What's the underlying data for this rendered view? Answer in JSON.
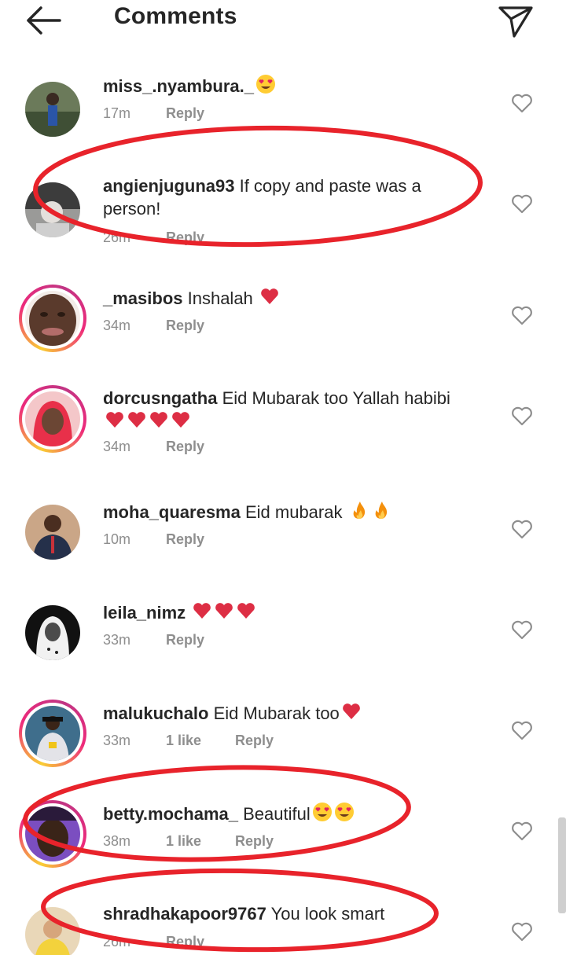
{
  "header": {
    "title": "Comments",
    "back_icon": "arrow-left-icon",
    "send_icon": "paper-plane-icon"
  },
  "comments": [
    {
      "username": "miss_.nyambura._",
      "text": "",
      "emojis": [
        "heart-eyes"
      ],
      "time": "17m",
      "likes": "",
      "reply": "Reply",
      "ring": false
    },
    {
      "username": "angienjuguna93",
      "text": " If copy and paste was a person!",
      "emojis": [],
      "time": "26m",
      "likes": "",
      "reply": "Reply",
      "ring": false
    },
    {
      "username": "_masibos",
      "text": " Inshalah ",
      "emojis": [
        "red-heart"
      ],
      "time": "34m",
      "likes": "",
      "reply": "Reply",
      "ring": true
    },
    {
      "username": "dorcusngatha",
      "text": " Eid Mubarak too Yallah habibi ",
      "emojis": [
        "red-heart",
        "red-heart",
        "red-heart",
        "red-heart"
      ],
      "time": "34m",
      "likes": "",
      "reply": "Reply",
      "ring": true
    },
    {
      "username": "moha_quaresma",
      "text": " Eid mubarak ",
      "emojis": [
        "fire",
        "fire"
      ],
      "time": "10m",
      "likes": "",
      "reply": "Reply",
      "ring": false
    },
    {
      "username": "leila_nimz",
      "text": " ",
      "emojis": [
        "red-heart",
        "red-heart",
        "red-heart"
      ],
      "time": "33m",
      "likes": "",
      "reply": "Reply",
      "ring": false
    },
    {
      "username": "malukuchalo",
      "text": " Eid Mubarak too",
      "emojis": [
        "red-heart"
      ],
      "time": "33m",
      "likes": "1 like",
      "reply": "Reply",
      "ring": true
    },
    {
      "username": "betty.mochama_",
      "text": " Beautiful",
      "emojis": [
        "heart-eyes",
        "heart-eyes"
      ],
      "time": "38m",
      "likes": "1 like",
      "reply": "Reply",
      "ring": true
    },
    {
      "username": "shradhakapoor9767",
      "text": " You look smart",
      "emojis": [],
      "time": "26m",
      "likes": "",
      "reply": "Reply",
      "ring": false
    }
  ],
  "colors": {
    "text": "#262626",
    "meta": "#8e8e8e",
    "annotation": "#e8232b",
    "heart": "#e0245e"
  }
}
